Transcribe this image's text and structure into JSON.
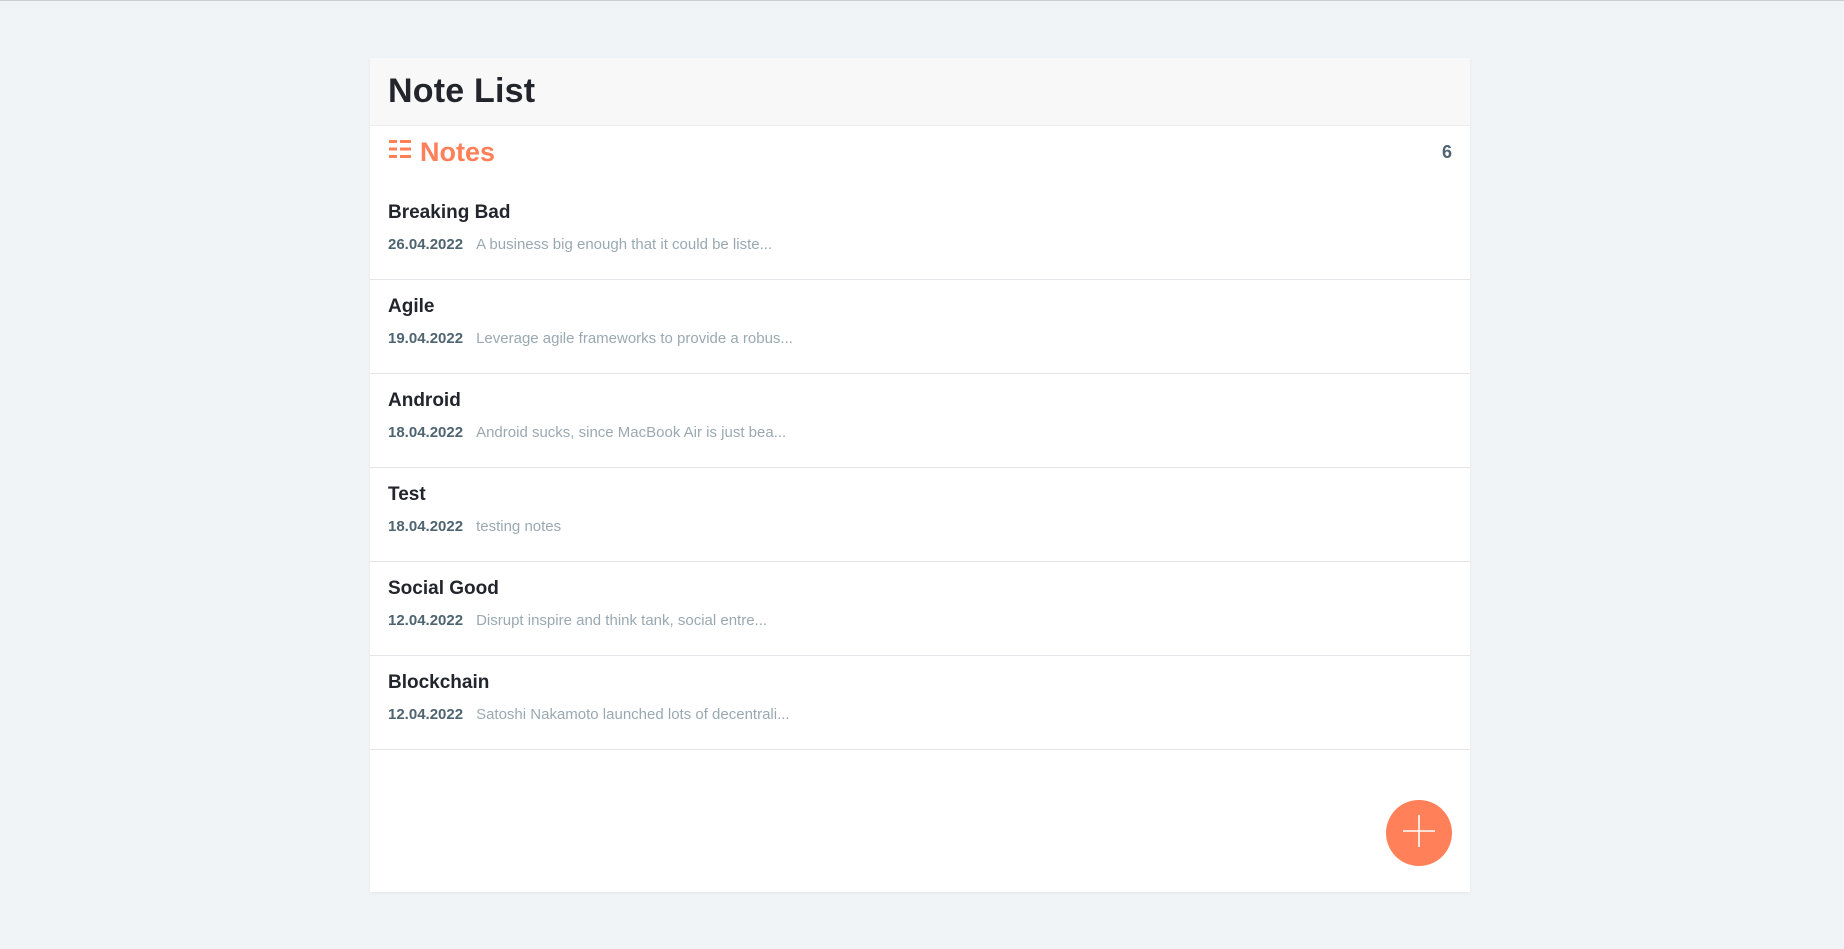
{
  "header": {
    "title": "Note List"
  },
  "notes_section": {
    "label": "Notes",
    "count": "6",
    "icon": "list-icon"
  },
  "notes": [
    {
      "title": "Breaking Bad",
      "date": "26.04.2022",
      "snippet": "A business big enough that it could be liste..."
    },
    {
      "title": "Agile",
      "date": "19.04.2022",
      "snippet": "Leverage agile frameworks to provide a robus..."
    },
    {
      "title": "Android",
      "date": "18.04.2022",
      "snippet": "Android sucks, since MacBook Air is just bea..."
    },
    {
      "title": "Test",
      "date": "18.04.2022",
      "snippet": "testing notes"
    },
    {
      "title": "Social Good",
      "date": "12.04.2022",
      "snippet": "Disrupt inspire and think tank, social entre..."
    },
    {
      "title": "Blockchain",
      "date": "12.04.2022",
      "snippet": "Satoshi Nakamoto launched lots of decentrali..."
    }
  ],
  "add_button": {
    "icon": "plus-icon"
  },
  "colors": {
    "accent": "#ff7f59",
    "background": "#f1f4f6",
    "title_text": "#22252b",
    "date_text": "#4e6470",
    "snippet_text": "#9aa9b1"
  }
}
